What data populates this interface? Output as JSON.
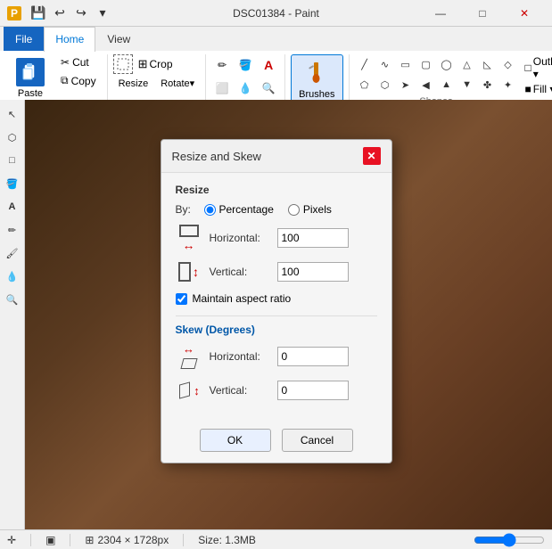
{
  "titlebar": {
    "app_title": "DSC01384 - Paint",
    "icon_label": "P",
    "min": "—",
    "max": "□",
    "close": "✕"
  },
  "ribbon": {
    "tabs": [
      "File",
      "Home",
      "View"
    ],
    "active_tab": "Home",
    "paste_label": "Paste",
    "cut_label": "Cut",
    "copy_label": "Copy",
    "crop_label": "Crop",
    "brushes_label": "Brushes",
    "shapes_label": "Shapes",
    "outline_label": "Outline ▾",
    "fill_label": "Fill ▾"
  },
  "dialog": {
    "title": "Resize and Skew",
    "close_btn": "✕",
    "resize_section": "Resize",
    "by_label": "By:",
    "percentage_label": "Percentage",
    "pixels_label": "Pixels",
    "horizontal_label": "Horizontal:",
    "vertical_label": "Vertical:",
    "horizontal_value": "100",
    "vertical_value": "100",
    "maintain_aspect": "Maintain aspect ratio",
    "skew_section": "Skew (Degrees)",
    "skew_h_label": "Horizontal:",
    "skew_v_label": "Vertical:",
    "skew_h_value": "0",
    "skew_v_value": "0",
    "ok_label": "OK",
    "cancel_label": "Cancel"
  },
  "statusbar": {
    "cursor_icon": "✛",
    "selection_icon": "▣",
    "dimensions": "2304 × 1728px",
    "size_label": "Size: 1.3MB"
  }
}
